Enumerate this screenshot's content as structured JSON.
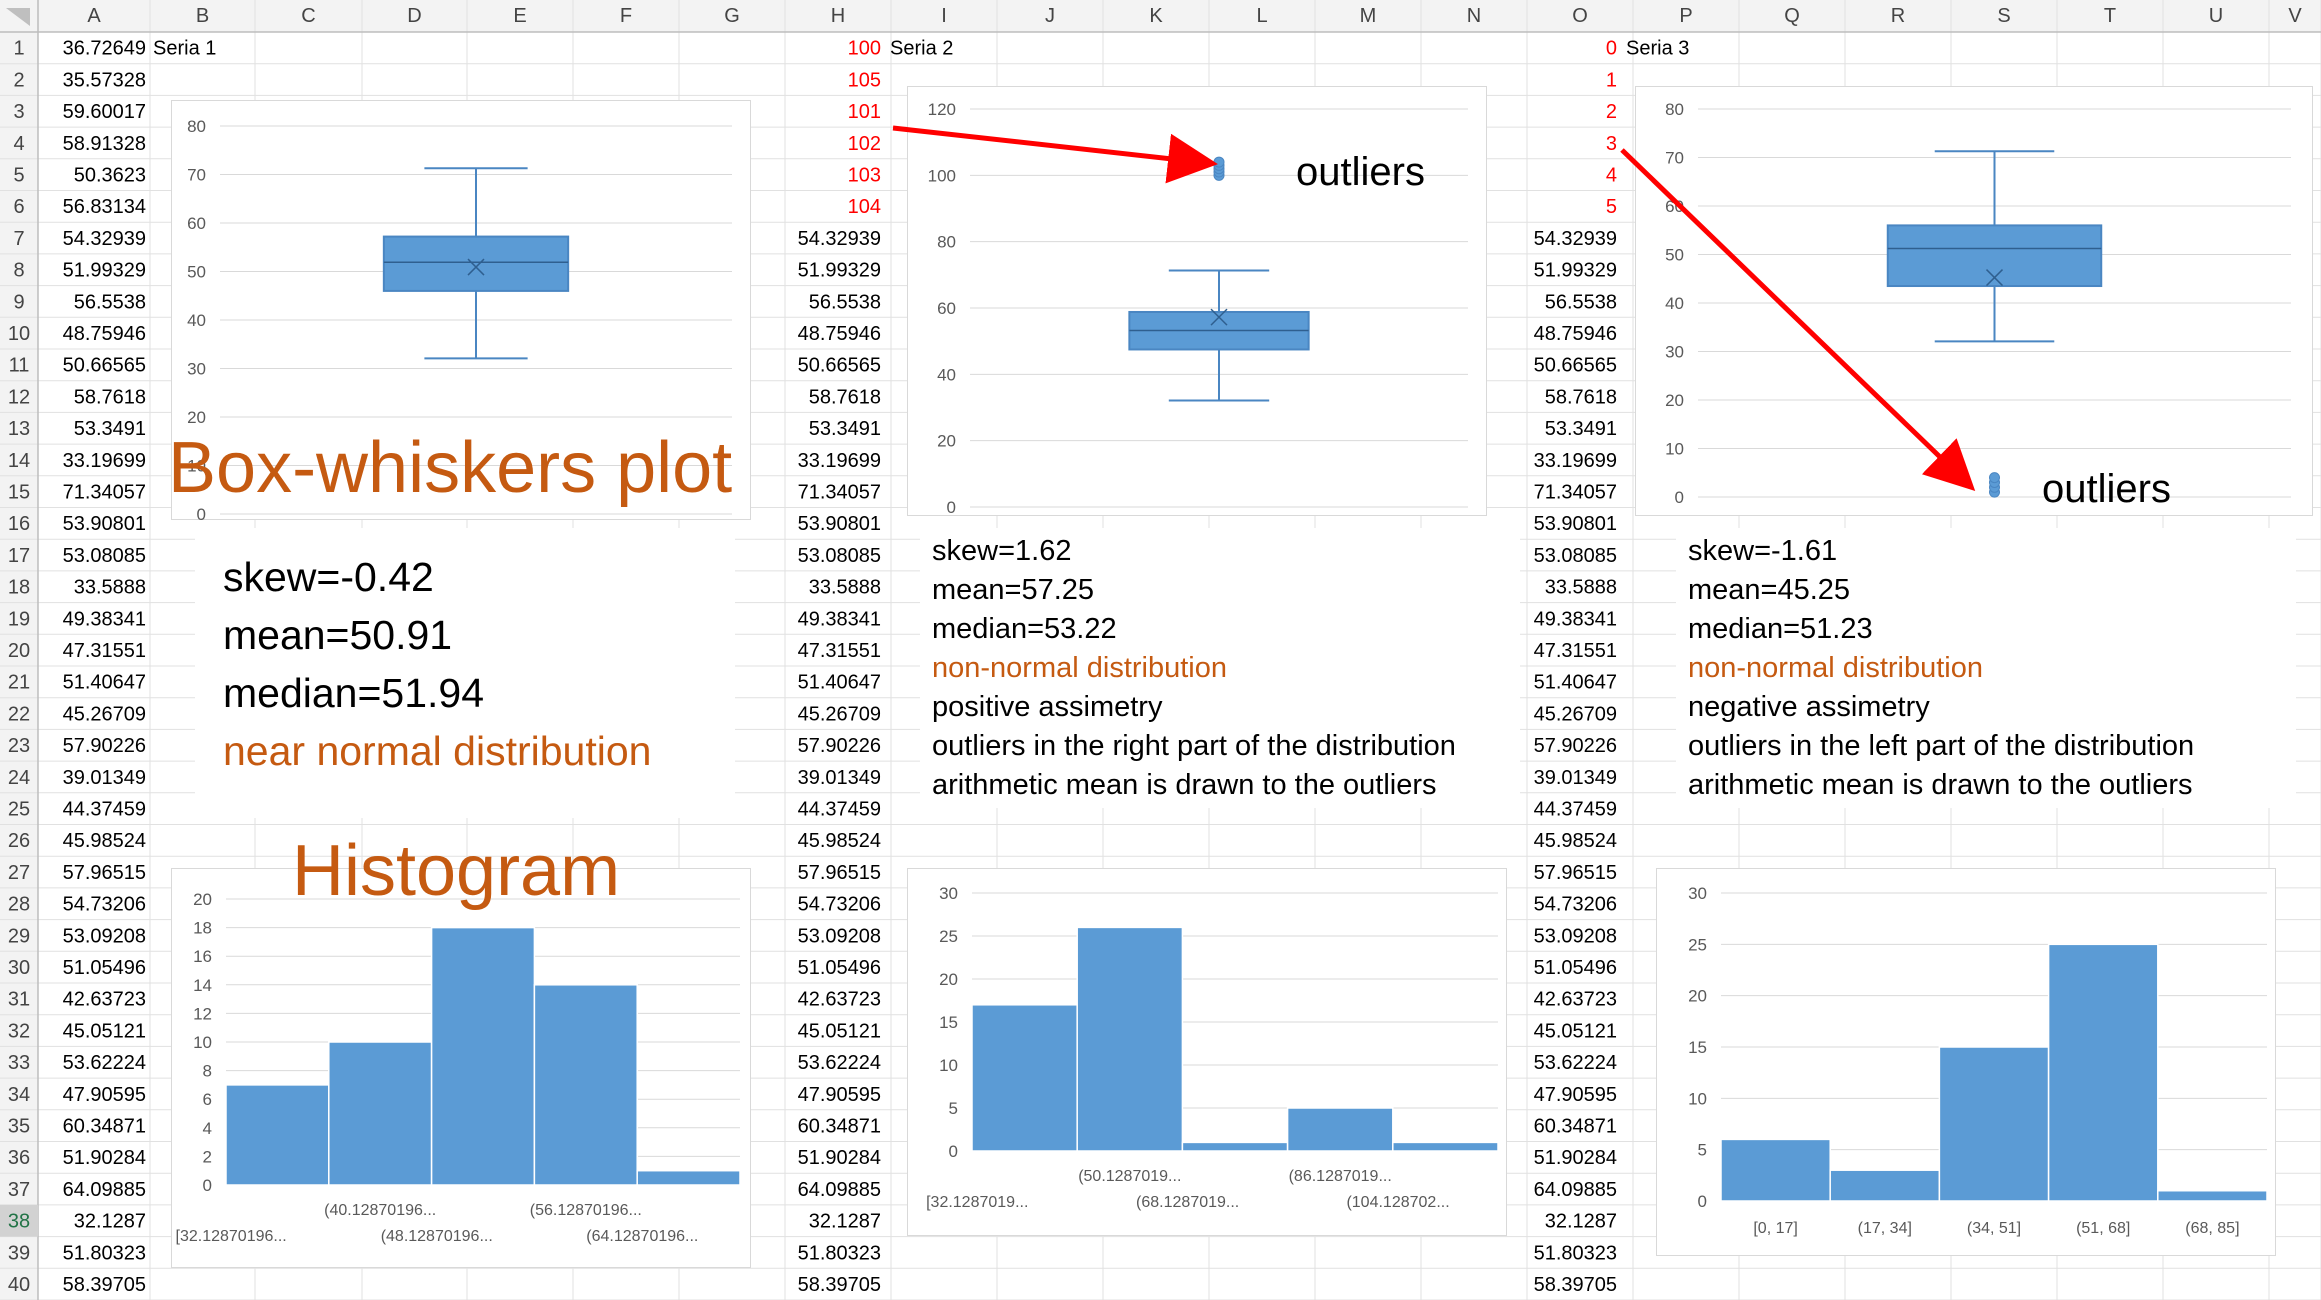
{
  "sheet": {
    "columns": [
      "A",
      "B",
      "C",
      "D",
      "E",
      "F",
      "G",
      "H",
      "I",
      "J",
      "K",
      "L",
      "M",
      "N",
      "O",
      "P",
      "Q",
      "R",
      "S",
      "T",
      "U",
      "V"
    ],
    "rows": [
      "1",
      "2",
      "3",
      "4",
      "5",
      "6",
      "7",
      "8",
      "9",
      "10",
      "11",
      "12",
      "13",
      "14",
      "15",
      "16",
      "17",
      "18",
      "19",
      "20",
      "21",
      "22",
      "23",
      "24",
      "25",
      "26",
      "27",
      "28",
      "29",
      "30",
      "31",
      "32",
      "33",
      "34",
      "35",
      "36",
      "37",
      "38",
      "39",
      "40"
    ],
    "active_row": "38",
    "col_A": [
      "36.72649",
      "35.57328",
      "59.60017",
      "58.91328",
      "50.3623",
      "56.83134",
      "54.32939",
      "51.99329",
      "56.5538",
      "48.75946",
      "50.66565",
      "58.7618",
      "53.3491",
      "33.19699",
      "71.34057",
      "53.90801",
      "53.08085",
      "33.5888",
      "49.38341",
      "47.31551",
      "51.40647",
      "45.26709",
      "57.90226",
      "39.01349",
      "44.37459",
      "45.98524",
      "57.96515",
      "54.73206",
      "53.09208",
      "51.05496",
      "42.63723",
      "45.05121",
      "53.62224",
      "47.90595",
      "60.34871",
      "51.90284",
      "64.09885",
      "32.1287",
      "51.80323",
      "58.39705"
    ],
    "col_H": [
      "100",
      "105",
      "101",
      "102",
      "103",
      "104",
      "54.32939",
      "51.99329",
      "56.5538",
      "48.75946",
      "50.66565",
      "58.7618",
      "53.3491",
      "33.19699",
      "71.34057",
      "53.90801",
      "53.08085",
      "33.5888",
      "49.38341",
      "47.31551",
      "51.40647",
      "45.26709",
      "57.90226",
      "39.01349",
      "44.37459",
      "45.98524",
      "57.96515",
      "54.73206",
      "53.09208",
      "51.05496",
      "42.63723",
      "45.05121",
      "53.62224",
      "47.90595",
      "60.34871",
      "51.90284",
      "64.09885",
      "32.1287",
      "51.80323",
      "58.39705"
    ],
    "col_O": [
      "0",
      "1",
      "2",
      "3",
      "4",
      "5",
      "54.32939",
      "51.99329",
      "56.5538",
      "48.75946",
      "50.66565",
      "58.7618",
      "53.3491",
      "33.19699",
      "71.34057",
      "53.90801",
      "53.08085",
      "33.5888",
      "49.38341",
      "47.31551",
      "51.40647",
      "45.26709",
      "57.90226",
      "39.01349",
      "44.37459",
      "45.98524",
      "57.96515",
      "54.73206",
      "53.09208",
      "51.05496",
      "42.63723",
      "45.05121",
      "53.62224",
      "47.90595",
      "60.34871",
      "51.90284",
      "64.09885",
      "32.1287",
      "51.80323",
      "58.39705"
    ],
    "red_rows": 6,
    "series_labels": {
      "b1": "Seria 1",
      "i1": "Seria 2",
      "p1": "Seria 3"
    }
  },
  "titles": {
    "boxplot": "Box-whiskers plot",
    "histogram": "Histogram"
  },
  "outlier_labels": [
    "outliers",
    "outliers"
  ],
  "stats": [
    {
      "skew": "skew=-0.42",
      "mean": "mean=50.91",
      "median": "median=51.94",
      "dist": "near normal distribution"
    },
    {
      "skew": "skew=1.62",
      "mean": "mean=57.25",
      "median": "median=53.22",
      "dist": "non-normal distribution",
      "asym": "positive assimetry",
      "outliers": "outliers in the right part of the distribution",
      "note": "arithmetic mean is drawn to the outliers"
    },
    {
      "skew": "skew=-1.61",
      "mean": "mean=45.25",
      "median": "median=51.23",
      "dist": "non-normal distribution",
      "asym": "negative assimetry",
      "outliers": "outliers in the left part of the distribution",
      "note": "arithmetic mean is drawn to the outliers"
    }
  ],
  "colors": {
    "box": "#5b9bd5",
    "box_edge": "#4a86c2",
    "arrow": "#ff0000",
    "title": "#c55a11",
    "red_cell": "#ff0000"
  },
  "chart_data": [
    {
      "type": "box",
      "name": "box-1",
      "ylim": [
        0,
        80
      ],
      "yticks": [
        0,
        10,
        20,
        30,
        40,
        50,
        60,
        70,
        80
      ],
      "min": 32.1,
      "q1": 46,
      "median": 51.9,
      "q3": 57.2,
      "max": 71.3,
      "mean": 50.91,
      "outliers": []
    },
    {
      "type": "box",
      "name": "box-2",
      "ylim": [
        0,
        120
      ],
      "yticks": [
        0,
        20,
        40,
        60,
        80,
        100,
        120
      ],
      "min": 32.1,
      "q1": 47.5,
      "median": 53.22,
      "q3": 58.8,
      "max": 71.3,
      "mean": 57.25,
      "outliers": [
        100,
        101,
        102,
        103,
        104
      ]
    },
    {
      "type": "box",
      "name": "box-3",
      "ylim": [
        0,
        80
      ],
      "yticks": [
        0,
        10,
        20,
        30,
        40,
        50,
        60,
        70,
        80
      ],
      "min": 32.1,
      "q1": 43.5,
      "median": 51.23,
      "q3": 56,
      "max": 71.3,
      "mean": 45.25,
      "outliers": [
        1,
        2,
        3,
        4
      ]
    },
    {
      "type": "bar",
      "name": "hist-1",
      "ylim": [
        0,
        20
      ],
      "yticks": [
        0,
        2,
        4,
        6,
        8,
        10,
        12,
        14,
        16,
        18,
        20
      ],
      "values": [
        7,
        10,
        18,
        14,
        1
      ],
      "categories": [
        "[32.12870196...",
        "(40.12870196...",
        "(48.12870196...",
        "(56.12870196...",
        "(64.12870196..."
      ]
    },
    {
      "type": "bar",
      "name": "hist-2",
      "ylim": [
        0,
        30
      ],
      "yticks": [
        0,
        5,
        10,
        15,
        20,
        25,
        30
      ],
      "values": [
        17,
        26,
        1,
        5,
        1
      ],
      "categories": [
        "[32.1287019...",
        "(50.1287019...",
        "(68.1287019...",
        "(86.1287019...",
        "(104.128702..."
      ]
    },
    {
      "type": "bar",
      "name": "hist-3",
      "ylim": [
        0,
        30
      ],
      "yticks": [
        0,
        5,
        10,
        15,
        20,
        25,
        30
      ],
      "values": [
        6,
        3,
        15,
        25,
        1
      ],
      "categories": [
        "[0, 17]",
        "(17, 34]",
        "(34, 51]",
        "(51, 68]",
        "(68, 85]"
      ]
    }
  ]
}
